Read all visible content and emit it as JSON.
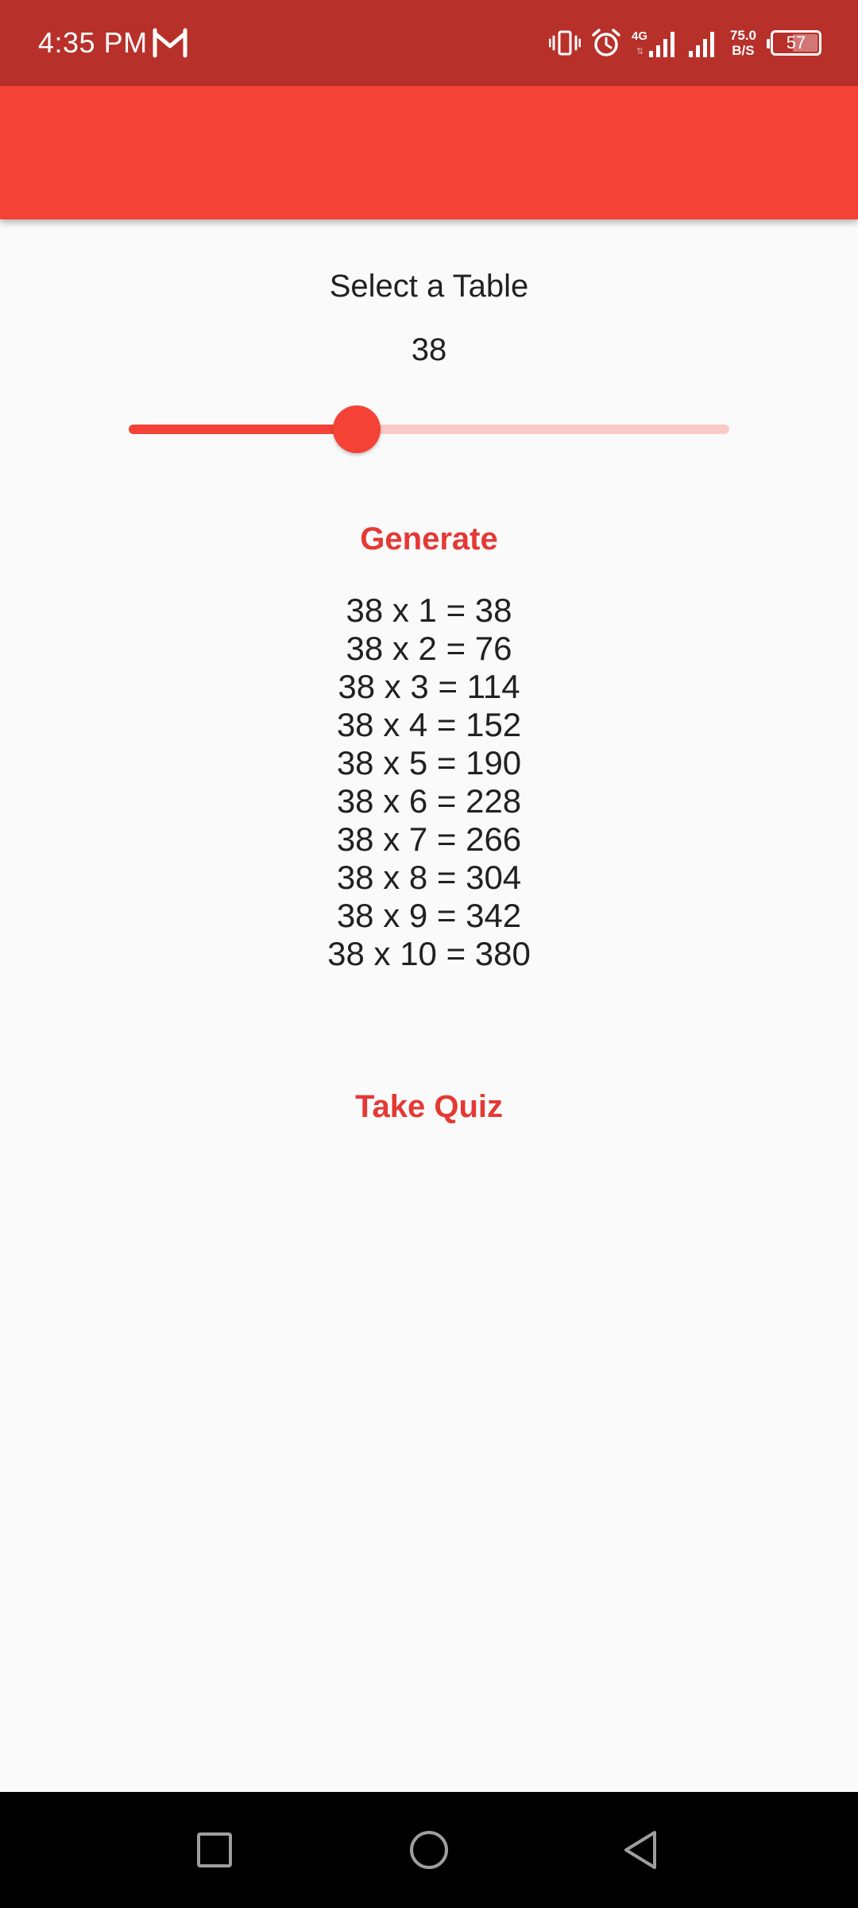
{
  "status_bar": {
    "time": "4:35 PM",
    "network_type": "4G",
    "net_speed_value": "75.0",
    "net_speed_unit": "B/S",
    "battery_level": "57",
    "battery_fraction": 0.57,
    "icons": [
      "gmail-icon",
      "vibrate-icon",
      "alarm-icon",
      "signal-4g-icon",
      "signal-icon",
      "battery-icon"
    ]
  },
  "theme": {
    "status_bar_color": "#b8302a",
    "app_bar_color": "#f44336",
    "accent_color": "#e53935",
    "slider_inactive_color": "#f8cbc7",
    "background_color": "#fafafa"
  },
  "main": {
    "title": "Select a Table",
    "slider": {
      "value": "38",
      "fraction": 0.38
    },
    "generate_label": "Generate",
    "table_rows": [
      "38 x 1 = 38",
      "38 x 2 = 76",
      "38 x 3 = 114",
      "38 x 4 = 152",
      "38 x 5 = 190",
      "38 x 6 = 228",
      "38 x 7 = 266",
      "38 x 8 = 304",
      "38 x 9 = 342",
      "38 x 10 = 380"
    ],
    "quiz_label": "Take Quiz"
  },
  "nav_bar": {
    "icons": [
      "recent-apps-icon",
      "home-icon",
      "back-icon"
    ]
  }
}
